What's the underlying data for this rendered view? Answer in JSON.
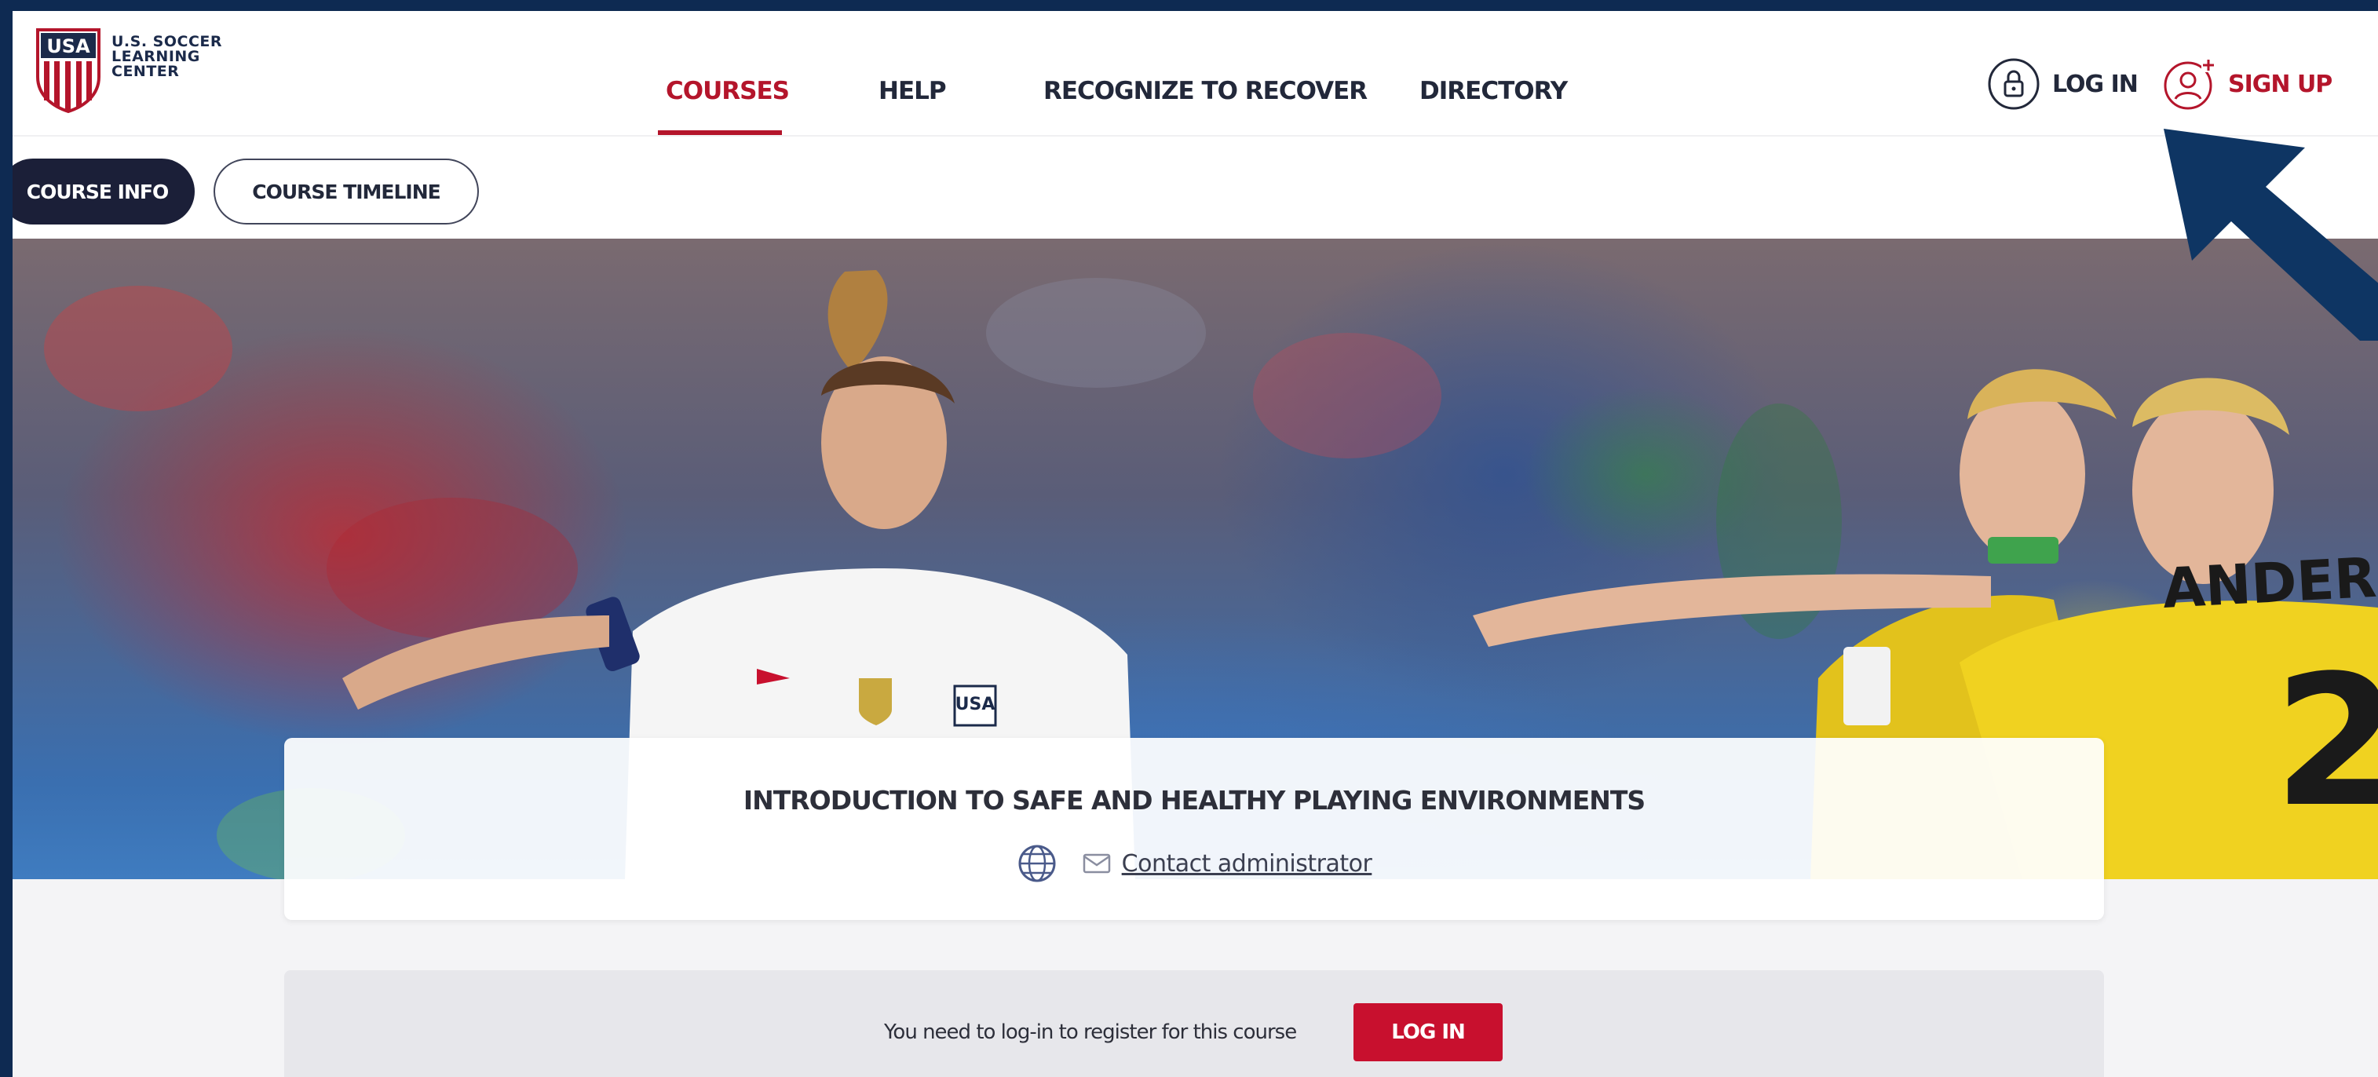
{
  "brand": {
    "crest_text": "USA",
    "lines": [
      "U.S. SOCCER",
      "LEARNING",
      "CENTER"
    ],
    "colors": {
      "navy": "#1b2a4a",
      "red": "#b4152b"
    }
  },
  "nav": {
    "items": [
      {
        "label": "COURSES",
        "active": true
      },
      {
        "label": "HELP",
        "active": false
      },
      {
        "label": "RECOGNIZE TO RECOVER",
        "active": false
      },
      {
        "label": "DIRECTORY",
        "active": false
      }
    ]
  },
  "auth": {
    "login_label": "LOG IN",
    "login_icon": "lock-icon",
    "signup_label": "SIGN UP",
    "signup_icon": "user-plus-icon"
  },
  "subnav": {
    "tabs": [
      {
        "label": "COURSE INFO",
        "active": true
      },
      {
        "label": "COURSE TIMELINE",
        "active": false
      }
    ]
  },
  "hero": {
    "image_icon": "soccer-match-photo"
  },
  "course": {
    "title": "INTRODUCTION TO SAFE AND HEALTHY PLAYING ENVIRONMENTS",
    "language_icon": "globe-icon",
    "contact_icon": "mail-icon",
    "contact_label": "Contact administrator"
  },
  "register": {
    "message": "You need to log-in to register for this course",
    "button_label": "LOG IN"
  },
  "annotation": {
    "arrow_icon": "pointer-arrow",
    "arrow_color": "#0e3563"
  },
  "colors": {
    "accent_red": "#c8102e",
    "dark_pill": "#1b1f38",
    "frame_border": "#0e2a52"
  }
}
